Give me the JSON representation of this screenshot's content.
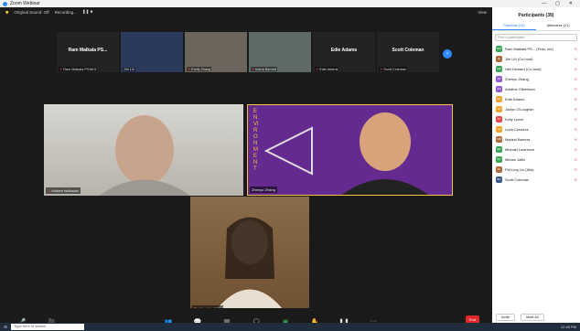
{
  "window": {
    "title": "Zoom Webinar",
    "controls": [
      "—",
      "▢",
      "✕"
    ]
  },
  "topbar": {
    "audio": "Original Sound: Off",
    "recording": "Recording...",
    "view": "View"
  },
  "strip": [
    {
      "name": "Ram Malkala PS...",
      "label": "Ram Malkala PSAKG"
    },
    {
      "name": "",
      "label": "Jim Lih"
    },
    {
      "name": "",
      "label": "Emily Zhang"
    },
    {
      "name": "",
      "label": "Iriana Barnett"
    },
    {
      "name": "Edie Adams",
      "label": "Edie Adams"
    },
    {
      "name": "Scott Coleman",
      "label": "Scott Coleman"
    }
  ],
  "videos": {
    "v1": "Kristen Ishikawa",
    "v2": "Zhenyu Zhang",
    "v3": "Pei-ling Liu (Alla)",
    "v2_text": "ENVIRONMENT"
  },
  "toolbar": [
    "Unmute",
    "Start Video",
    "Participants",
    "Q&A",
    "Polls",
    "Chat",
    "Share Screen",
    "Raise Hand",
    "Pause/Stop Recording",
    "More"
  ],
  "toolbar_end": "End",
  "panel": {
    "title": "Participants (39)",
    "tabs": [
      "Panelists (18)",
      "Attendees (21)"
    ],
    "search": "Find a participant",
    "people": [
      {
        "name": "Ram Malkala PS... (Host, me)",
        "color": "#3aa757",
        "initials": "RM"
      },
      {
        "name": "Jim Lih (Co-host)",
        "color": "#b06a3c",
        "initials": "JL"
      },
      {
        "name": "Heli Howard (Co-host)",
        "color": "#3aa757",
        "initials": "HH"
      },
      {
        "name": "Zhenyu Zhang",
        "color": "#8e5bd4",
        "initials": "ZZ"
      },
      {
        "name": "Arkatos Gilbertson",
        "color": "#8e5bd4",
        "initials": "AG"
      },
      {
        "name": "Edie Adams",
        "color": "#f0a530",
        "initials": "EA"
      },
      {
        "name": "Jaclyn O'Loughlin",
        "color": "#f0a530",
        "initials": "JO"
      },
      {
        "name": "Kelly Lynch",
        "color": "#e5484d",
        "initials": "KL"
      },
      {
        "name": "Luna Cavazos",
        "color": "#f0a530",
        "initials": "LC"
      },
      {
        "name": "Marisol Barrera",
        "color": "#b06a3c",
        "initials": "MB"
      },
      {
        "name": "Michael Lawrence",
        "color": "#3aa757",
        "initials": "ML"
      },
      {
        "name": "Miriam Jaffa",
        "color": "#3aa757",
        "initials": "MJ"
      },
      {
        "name": "Pei-Ling Liu (Alla)",
        "color": "#b06a3c",
        "initials": "PL"
      },
      {
        "name": "Scott Coleman",
        "color": "#3a5a8a",
        "initials": "SC"
      }
    ],
    "footer": [
      "Invite",
      "Mute All"
    ]
  },
  "taskbar": {
    "search": "Type here to search",
    "time": "12:48 PM"
  }
}
